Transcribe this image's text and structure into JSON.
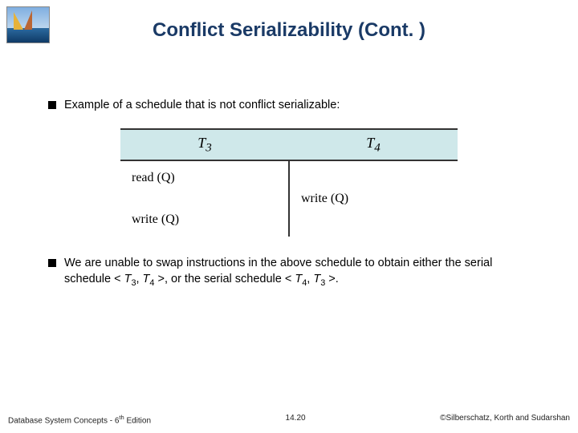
{
  "title": "Conflict Serializability (Cont. )",
  "bullets": {
    "b1": "Example of a schedule that is not conflict serializable:",
    "b2_html": "We are unable to swap instructions in the above schedule to obtain either the serial schedule < <i>T</i><span class=\"sub\">3</span>, <i>T</i><span class=\"sub\">4</span> >, or the serial schedule < <i>T</i><span class=\"sub\">4</span>, <i>T</i><span class=\"sub\">3</span> >."
  },
  "schedule": {
    "header": {
      "c1_html": "T<sub>3</sub>",
      "c2_html": "T<sub>4</sub>"
    },
    "ops": {
      "left_r1": "read (Q)",
      "right_r2": "write (Q)",
      "left_r3": "write (Q)"
    }
  },
  "footer": {
    "left_html": "Database System Concepts - 6<span class=\"sup\">th</span> Edition",
    "center": "14.20",
    "right": "©Silberschatz, Korth and Sudarshan"
  }
}
